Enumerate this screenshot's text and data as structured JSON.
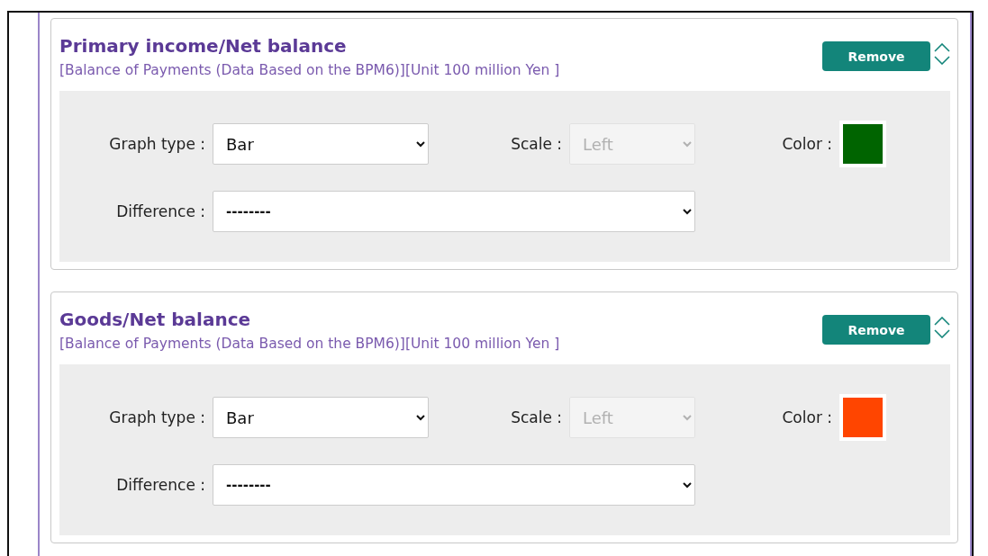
{
  "series": [
    {
      "title": "Primary income/Net balance",
      "subtitle": "[Balance of Payments (Data Based on the BPM6)][Unit 100 million Yen ]",
      "remove_label": "Remove",
      "graph_type_label": "Graph type :",
      "graph_type": "Bar",
      "scale_label": "Scale :",
      "scale": "Left",
      "scale_disabled": true,
      "color_label": "Color :",
      "color": "#006400",
      "difference_label": "Difference :",
      "difference": "--------"
    },
    {
      "title": "Goods/Net balance",
      "subtitle": "[Balance of Payments (Data Based on the BPM6)][Unit 100 million Yen ]",
      "remove_label": "Remove",
      "graph_type_label": "Graph type :",
      "graph_type": "Bar",
      "scale_label": "Scale :",
      "scale": "Left",
      "scale_disabled": true,
      "color_label": "Color :",
      "color": "#ff4500",
      "difference_label": "Difference :",
      "difference": "--------"
    }
  ]
}
